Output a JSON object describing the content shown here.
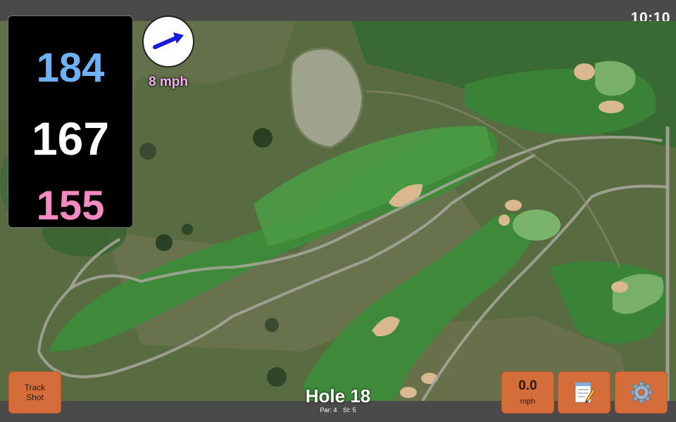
{
  "status_bar": {
    "time": "10:10"
  },
  "distances": {
    "back": "184",
    "middle": "167",
    "front": "155"
  },
  "wind": {
    "speed_label": "8 mph",
    "direction_icon": "arrow-icon"
  },
  "hole": {
    "title": "Hole 18",
    "par_label": "Par: 4",
    "si_label": "SI: 5"
  },
  "buttons": {
    "track_shot_line1": "Track",
    "track_shot_line2": "Shot",
    "speed_value": "0.0",
    "speed_unit": "mph",
    "notes_icon": "notepad-icon",
    "settings_icon": "gear-icon"
  },
  "colors": {
    "back_distance": "#6fb1f5",
    "middle_distance": "#ffffff",
    "front_distance": "#f58ac2",
    "button_fill": "#d46d3a",
    "wind_label": "#f3b0ef"
  }
}
